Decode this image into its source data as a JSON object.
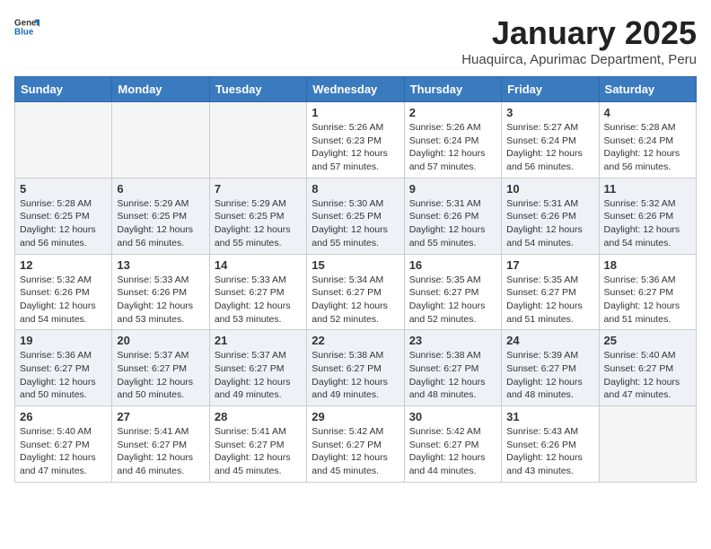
{
  "header": {
    "logo_general": "General",
    "logo_blue": "Blue",
    "month_title": "January 2025",
    "subtitle": "Huaquirca, Apurimac Department, Peru"
  },
  "days_of_week": [
    "Sunday",
    "Monday",
    "Tuesday",
    "Wednesday",
    "Thursday",
    "Friday",
    "Saturday"
  ],
  "weeks": [
    [
      {
        "day": "",
        "info": ""
      },
      {
        "day": "",
        "info": ""
      },
      {
        "day": "",
        "info": ""
      },
      {
        "day": "1",
        "info": "Sunrise: 5:26 AM\nSunset: 6:23 PM\nDaylight: 12 hours\nand 57 minutes."
      },
      {
        "day": "2",
        "info": "Sunrise: 5:26 AM\nSunset: 6:24 PM\nDaylight: 12 hours\nand 57 minutes."
      },
      {
        "day": "3",
        "info": "Sunrise: 5:27 AM\nSunset: 6:24 PM\nDaylight: 12 hours\nand 56 minutes."
      },
      {
        "day": "4",
        "info": "Sunrise: 5:28 AM\nSunset: 6:24 PM\nDaylight: 12 hours\nand 56 minutes."
      }
    ],
    [
      {
        "day": "5",
        "info": "Sunrise: 5:28 AM\nSunset: 6:25 PM\nDaylight: 12 hours\nand 56 minutes."
      },
      {
        "day": "6",
        "info": "Sunrise: 5:29 AM\nSunset: 6:25 PM\nDaylight: 12 hours\nand 56 minutes."
      },
      {
        "day": "7",
        "info": "Sunrise: 5:29 AM\nSunset: 6:25 PM\nDaylight: 12 hours\nand 55 minutes."
      },
      {
        "day": "8",
        "info": "Sunrise: 5:30 AM\nSunset: 6:25 PM\nDaylight: 12 hours\nand 55 minutes."
      },
      {
        "day": "9",
        "info": "Sunrise: 5:31 AM\nSunset: 6:26 PM\nDaylight: 12 hours\nand 55 minutes."
      },
      {
        "day": "10",
        "info": "Sunrise: 5:31 AM\nSunset: 6:26 PM\nDaylight: 12 hours\nand 54 minutes."
      },
      {
        "day": "11",
        "info": "Sunrise: 5:32 AM\nSunset: 6:26 PM\nDaylight: 12 hours\nand 54 minutes."
      }
    ],
    [
      {
        "day": "12",
        "info": "Sunrise: 5:32 AM\nSunset: 6:26 PM\nDaylight: 12 hours\nand 54 minutes."
      },
      {
        "day": "13",
        "info": "Sunrise: 5:33 AM\nSunset: 6:26 PM\nDaylight: 12 hours\nand 53 minutes."
      },
      {
        "day": "14",
        "info": "Sunrise: 5:33 AM\nSunset: 6:27 PM\nDaylight: 12 hours\nand 53 minutes."
      },
      {
        "day": "15",
        "info": "Sunrise: 5:34 AM\nSunset: 6:27 PM\nDaylight: 12 hours\nand 52 minutes."
      },
      {
        "day": "16",
        "info": "Sunrise: 5:35 AM\nSunset: 6:27 PM\nDaylight: 12 hours\nand 52 minutes."
      },
      {
        "day": "17",
        "info": "Sunrise: 5:35 AM\nSunset: 6:27 PM\nDaylight: 12 hours\nand 51 minutes."
      },
      {
        "day": "18",
        "info": "Sunrise: 5:36 AM\nSunset: 6:27 PM\nDaylight: 12 hours\nand 51 minutes."
      }
    ],
    [
      {
        "day": "19",
        "info": "Sunrise: 5:36 AM\nSunset: 6:27 PM\nDaylight: 12 hours\nand 50 minutes."
      },
      {
        "day": "20",
        "info": "Sunrise: 5:37 AM\nSunset: 6:27 PM\nDaylight: 12 hours\nand 50 minutes."
      },
      {
        "day": "21",
        "info": "Sunrise: 5:37 AM\nSunset: 6:27 PM\nDaylight: 12 hours\nand 49 minutes."
      },
      {
        "day": "22",
        "info": "Sunrise: 5:38 AM\nSunset: 6:27 PM\nDaylight: 12 hours\nand 49 minutes."
      },
      {
        "day": "23",
        "info": "Sunrise: 5:38 AM\nSunset: 6:27 PM\nDaylight: 12 hours\nand 48 minutes."
      },
      {
        "day": "24",
        "info": "Sunrise: 5:39 AM\nSunset: 6:27 PM\nDaylight: 12 hours\nand 48 minutes."
      },
      {
        "day": "25",
        "info": "Sunrise: 5:40 AM\nSunset: 6:27 PM\nDaylight: 12 hours\nand 47 minutes."
      }
    ],
    [
      {
        "day": "26",
        "info": "Sunrise: 5:40 AM\nSunset: 6:27 PM\nDaylight: 12 hours\nand 47 minutes."
      },
      {
        "day": "27",
        "info": "Sunrise: 5:41 AM\nSunset: 6:27 PM\nDaylight: 12 hours\nand 46 minutes."
      },
      {
        "day": "28",
        "info": "Sunrise: 5:41 AM\nSunset: 6:27 PM\nDaylight: 12 hours\nand 45 minutes."
      },
      {
        "day": "29",
        "info": "Sunrise: 5:42 AM\nSunset: 6:27 PM\nDaylight: 12 hours\nand 45 minutes."
      },
      {
        "day": "30",
        "info": "Sunrise: 5:42 AM\nSunset: 6:27 PM\nDaylight: 12 hours\nand 44 minutes."
      },
      {
        "day": "31",
        "info": "Sunrise: 5:43 AM\nSunset: 6:26 PM\nDaylight: 12 hours\nand 43 minutes."
      },
      {
        "day": "",
        "info": ""
      }
    ]
  ]
}
